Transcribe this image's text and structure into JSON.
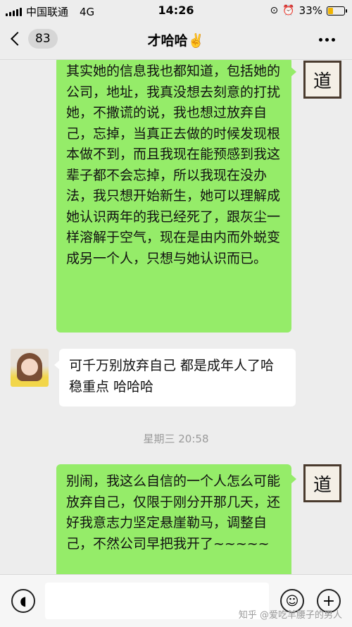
{
  "status_bar": {
    "carrier": "中国联通",
    "network": "4G",
    "time": "14:26",
    "battery_percent": "33%",
    "battery_level": 0.33
  },
  "navbar": {
    "back_count": "83",
    "title": "才哈哈✌️"
  },
  "messages": [
    {
      "sender": "me",
      "text": "其实她的信息我也都知道，包括她的公司，地址，我真没想去刻意的打扰她，不撒谎的说，我也想过放弃自己，忘掉，当真正去做的时候发现根本做不到，而且我现在能预感到我这辈子都不会忘掉，所以我现在没办法，我只想开始新生，她可以理解成她认识两年的我已经死了，跟灰尘一样溶解于空气，现在是由内而外蜕变成另一个人，只想与她认识而已。"
    },
    {
      "sender": "her",
      "text": "可千万别放弃自己 都是成年人了哈 稳重点 哈哈哈"
    },
    {
      "sender": "me",
      "text": "别闹，我这么自信的一个人怎么可能放弃自己，仅限于刚分开那几天，还好我意志力坚定悬崖勒马，调整自己，不然公司早把我开了~~~~~"
    }
  ],
  "timestamp": "星期三 20:58",
  "avatar_me_glyph": "道",
  "watermark": "知乎 @爱吃羊腰子的男人",
  "colors": {
    "my_bubble": "#95ec69",
    "their_bubble": "#ffffff",
    "background": "#ededed"
  },
  "icons": [
    "voice-icon",
    "emoji-icon",
    "plus-icon",
    "back-chevron-icon",
    "more-icon"
  ]
}
